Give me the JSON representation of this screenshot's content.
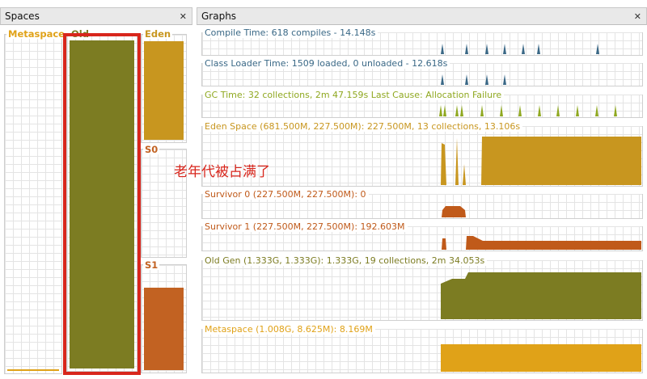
{
  "spaces_panel": {
    "title": "Spaces",
    "close_glyph": "✕",
    "boxes": {
      "metaspace": {
        "label": "Metaspace",
        "color": "#e0a218",
        "fill_ratio": 0.01
      },
      "old": {
        "label": "Old",
        "color": "#7c7c22",
        "fill_ratio": 1.0
      },
      "eden": {
        "label": "Eden",
        "color": "#c8961f",
        "fill_ratio": 1.0
      },
      "s0": {
        "label": "S0",
        "color": "#c26222",
        "fill_ratio": 0.0
      },
      "s1": {
        "label": "S1",
        "color": "#c26222",
        "fill_ratio": 0.8
      }
    }
  },
  "graphs_panel": {
    "title": "Graphs",
    "close_glyph": "✕",
    "graphs": [
      {
        "key": "compile",
        "title": "Compile Time: 618 compiles - 14.148s",
        "color": "#3a6886"
      },
      {
        "key": "classloader",
        "title": "Class Loader Time: 1509 loaded, 0 unloaded - 12.618s",
        "color": "#3a6886"
      },
      {
        "key": "gc",
        "title": "GC Time: 32 collections, 2m 47.159s  Last Cause: Allocation Failure",
        "color": "#8fa820"
      },
      {
        "key": "eden",
        "title": "Eden Space (681.500M, 227.500M): 227.500M, 13 collections, 13.106s",
        "color": "#c8961f"
      },
      {
        "key": "s0",
        "title": "Survivor 0 (227.500M, 227.500M): 0",
        "color": "#c05a1a"
      },
      {
        "key": "s1",
        "title": "Survivor 1 (227.500M, 227.500M): 192.603M",
        "color": "#c05a1a"
      },
      {
        "key": "old",
        "title": "Old Gen (1.333G, 1.333G): 1.333G, 19 collections, 2m 34.053s",
        "color": "#7c7c22"
      },
      {
        "key": "metaspace",
        "title": "Metaspace (1.008G, 8.625M): 8.169M",
        "color": "#e0a218"
      }
    ]
  },
  "annotation": {
    "text": "老年代被占满了",
    "color": "#d8261c"
  }
}
